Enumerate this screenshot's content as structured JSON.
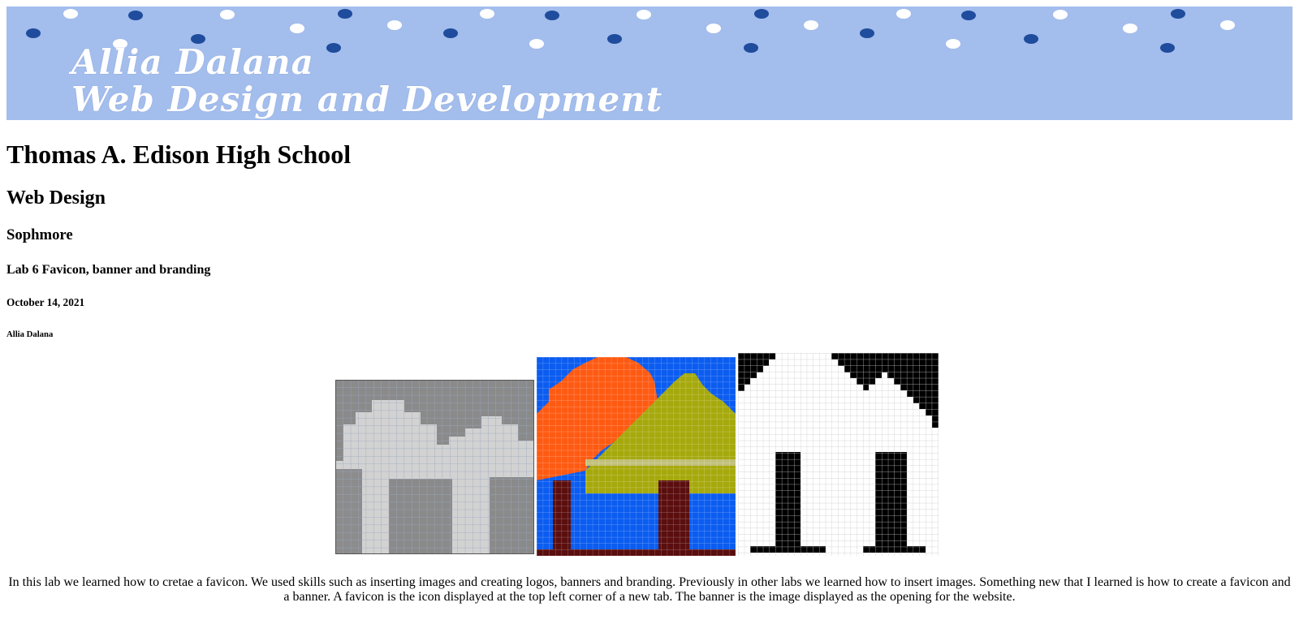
{
  "banner": {
    "line1": "Allia Dalana",
    "line2": "Web Design and Development",
    "background": "#a3bdec",
    "dot_dark": "#1f4c9c",
    "dot_light": "#ffffff"
  },
  "headings": {
    "h1": "Thomas A. Edison High School",
    "h2": "Web Design",
    "h3": "Sophmore",
    "h4": "Lab 6 Favicon, banner and branding",
    "h5": "October 14, 2021",
    "h6": "Allia Dalana"
  },
  "images": [
    {
      "name": "pencil-sketch-house-image"
    },
    {
      "name": "colored-pixel-house-image"
    },
    {
      "name": "black-white-pixel-house-image"
    }
  ],
  "paragraph": "In this lab we learned how to cretae a favicon. We used skills such as inserting images and creating logos, banners and branding. Previously in other labs we learned how to insert images. Something new that I learned is how to create a favicon and a banner. A favicon is the icon displayed at the top left corner of a new tab. The banner is the image displayed as the opening for the website."
}
